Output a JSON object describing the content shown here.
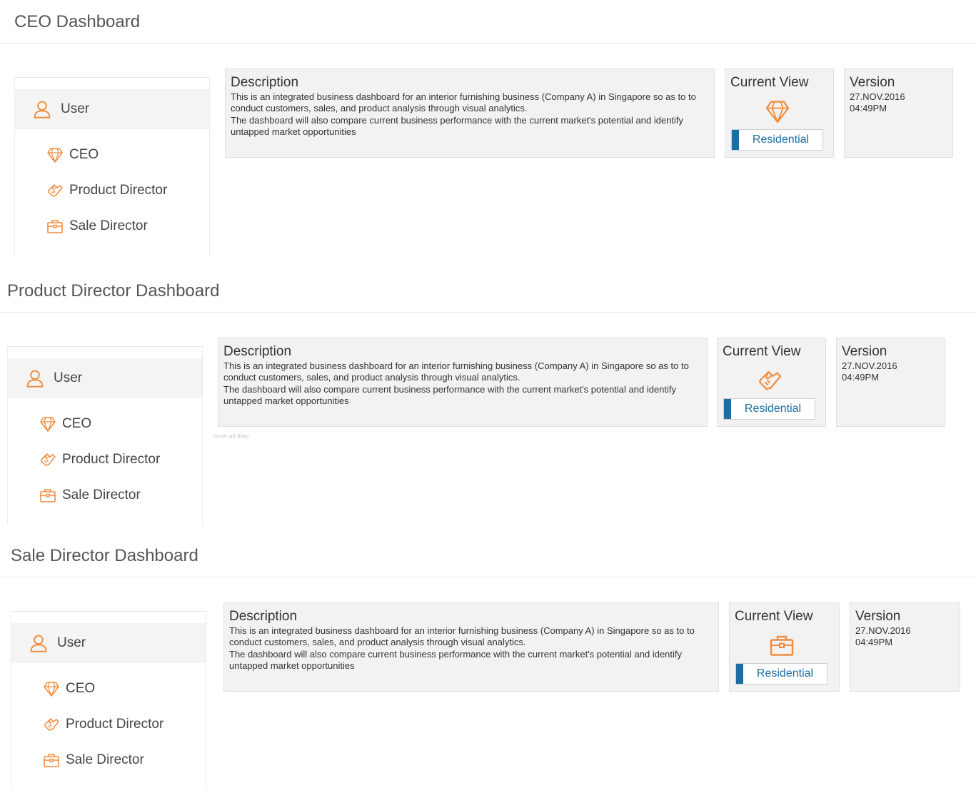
{
  "colors": {
    "accent": "#f28b3a",
    "button_bar": "#1b6e9f",
    "panel_bg": "#f2f2f2",
    "user_row_bg": "#f4f4f5"
  },
  "sidebar": {
    "user_label": "User",
    "user_icon": "user-icon",
    "items": [
      {
        "label": "CEO",
        "icon": "diamond-icon"
      },
      {
        "label": "Product Director",
        "icon": "handshake-icon"
      },
      {
        "label": "Sale Director",
        "icon": "briefcase-icon"
      }
    ]
  },
  "description": {
    "heading": "Description",
    "line1": "This is an integrated business dashboard for an interior furnishing business (Company A) in Singapore so as to to conduct customers, sales, and product analysis through visual analytics.",
    "line2": "The dashboard will also compare current business performance with the current market's potential and identify untapped market opportunities"
  },
  "current_view": {
    "heading": "Current View",
    "button_label": "Residential"
  },
  "version": {
    "heading": "Version",
    "date": "27.NOV.2016",
    "time": "04:49PM"
  },
  "sections": [
    {
      "title": "CEO Dashboard",
      "current_view_icon": "diamond-icon"
    },
    {
      "title": "Product Director Dashboard",
      "current_view_icon": "handshake-icon",
      "ghost_text": "reset all filter"
    },
    {
      "title": "Sale Director Dashboard",
      "current_view_icon": "briefcase-icon"
    }
  ]
}
